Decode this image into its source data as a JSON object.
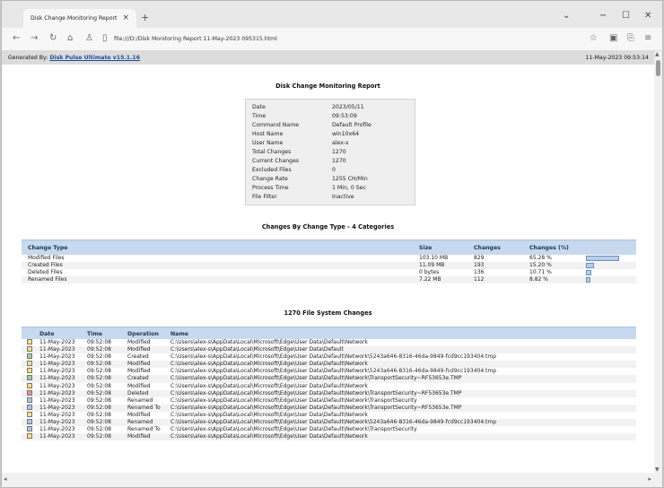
{
  "browser": {
    "tab_title": "Disk Change Monitoring Report",
    "tab_close": "×",
    "new_tab": "+",
    "address": "file:///D:/Disk Monitoring Report 11-May-2023 095315.html",
    "icons": [
      "back-icon",
      "forward-icon",
      "reload-icon",
      "home-icon",
      "profile-icon",
      "page-icon",
      "favorite-icon",
      "collections-icon",
      "extensions-icon",
      "favorites-bar-icon"
    ],
    "window_controls": {
      "minimize": "−",
      "maximize": "☐",
      "close": "✕",
      "chevron": "⌄"
    }
  },
  "report": {
    "generated_by_label": "Generated By:",
    "generated_by_link": "Disk Pulse Ultimate v15.1.16",
    "generated_at": "11-May-2023 09:53:14",
    "title": "Disk Change Monitoring Report",
    "summary": [
      {
        "label": "Date",
        "value": "2023/05/11"
      },
      {
        "label": "Time",
        "value": "09:53:09"
      },
      {
        "label": "Command Name",
        "value": "Default Profile"
      },
      {
        "label": "Host Name",
        "value": "win10x64"
      },
      {
        "label": "User Name",
        "value": "alex-s"
      },
      {
        "label": "Total Changes",
        "value": "1270"
      },
      {
        "label": "Current Changes",
        "value": "1270"
      },
      {
        "label": "Excluded Files",
        "value": "0"
      },
      {
        "label": "Change Rate",
        "value": "1255 CH/Min"
      },
      {
        "label": "Process Time",
        "value": "1 Min, 0 Sec"
      },
      {
        "label": "File Filter",
        "value": "Inactive"
      }
    ],
    "change_types_title": "Changes By Change Type - 4 Categories",
    "change_types_headers": {
      "type": "Change Type",
      "size": "Size",
      "changes": "Changes",
      "percent": "Changes (%)"
    },
    "change_types": [
      {
        "type": "Modified Files",
        "size": "103.10 MB",
        "changes": "829",
        "percent": "65.28 %",
        "fraction": 0.6528
      },
      {
        "type": "Created Files",
        "size": "11.09 MB",
        "changes": "193",
        "percent": "15.20 %",
        "fraction": 0.152
      },
      {
        "type": "Deleted Files",
        "size": "0 bytes",
        "changes": "136",
        "percent": "10.71 %",
        "fraction": 0.1071
      },
      {
        "type": "Renamed Files",
        "size": "7.22 MB",
        "changes": "112",
        "percent": "8.82 %",
        "fraction": 0.0882
      }
    ],
    "fs_title": "1270 File System Changes",
    "fs_headers": {
      "date": "Date",
      "time": "Time",
      "operation": "Operation",
      "name": "Name"
    },
    "operation_colors": {
      "Modified": "#f6e27a",
      "Created": "#8fd68f",
      "Deleted": "#f08c8c",
      "Renamed": "#a9c8ec",
      "Renamed To": "#a9c8ec"
    },
    "fs_rows": [
      {
        "date": "11-May-2023",
        "time": "09:52:08",
        "operation": "Modified",
        "name": "C:\\Users\\alex-s\\AppData\\Local\\Microsoft\\Edge\\User Data\\Default\\Network"
      },
      {
        "date": "11-May-2023",
        "time": "09:52:08",
        "operation": "Modified",
        "name": "C:\\Users\\alex-s\\AppData\\Local\\Microsoft\\Edge\\User Data\\Default"
      },
      {
        "date": "11-May-2023",
        "time": "09:52:08",
        "operation": "Created",
        "name": "C:\\Users\\alex-s\\AppData\\Local\\Microsoft\\Edge\\User Data\\Default\\Network\\5243a646-8316-46da-9849-fcd9cc193404.tmp"
      },
      {
        "date": "11-May-2023",
        "time": "09:52:08",
        "operation": "Modified",
        "name": "C:\\Users\\alex-s\\AppData\\Local\\Microsoft\\Edge\\User Data\\Default\\Network"
      },
      {
        "date": "11-May-2023",
        "time": "09:52:08",
        "operation": "Modified",
        "name": "C:\\Users\\alex-s\\AppData\\Local\\Microsoft\\Edge\\User Data\\Default\\Network\\5243a646-8316-46da-9849-fcd9cc193404.tmp"
      },
      {
        "date": "11-May-2023",
        "time": "09:52:08",
        "operation": "Created",
        "name": "C:\\Users\\alex-s\\AppData\\Local\\Microsoft\\Edge\\User Data\\Default\\Network\\TransportSecurity~RF53653e.TMP"
      },
      {
        "date": "11-May-2023",
        "time": "09:52:08",
        "operation": "Modified",
        "name": "C:\\Users\\alex-s\\AppData\\Local\\Microsoft\\Edge\\User Data\\Default\\Network"
      },
      {
        "date": "11-May-2023",
        "time": "09:52:08",
        "operation": "Deleted",
        "name": "C:\\Users\\alex-s\\AppData\\Local\\Microsoft\\Edge\\User Data\\Default\\Network\\TransportSecurity~RF53653e.TMP"
      },
      {
        "date": "11-May-2023",
        "time": "09:52:08",
        "operation": "Renamed",
        "name": "C:\\Users\\alex-s\\AppData\\Local\\Microsoft\\Edge\\User Data\\Default\\Network\\TransportSecurity"
      },
      {
        "date": "11-May-2023",
        "time": "09:52:08",
        "operation": "Renamed To",
        "name": "C:\\Users\\alex-s\\AppData\\Local\\Microsoft\\Edge\\User Data\\Default\\Network\\TransportSecurity~RF53653e.TMP"
      },
      {
        "date": "11-May-2023",
        "time": "09:52:08",
        "operation": "Modified",
        "name": "C:\\Users\\alex-s\\AppData\\Local\\Microsoft\\Edge\\User Data\\Default\\Network"
      },
      {
        "date": "11-May-2023",
        "time": "09:52:08",
        "operation": "Renamed",
        "name": "C:\\Users\\alex-s\\AppData\\Local\\Microsoft\\Edge\\User Data\\Default\\Network\\5243a646-8316-46da-9849-fcd9cc193404.tmp"
      },
      {
        "date": "11-May-2023",
        "time": "09:52:08",
        "operation": "Renamed To",
        "name": "C:\\Users\\alex-s\\AppData\\Local\\Microsoft\\Edge\\User Data\\Default\\Network\\TransportSecurity"
      },
      {
        "date": "11-May-2023",
        "time": "09:52:08",
        "operation": "Modified",
        "name": "C:\\Users\\alex-s\\AppData\\Local\\Microsoft\\Edge\\User Data\\Default\\Network"
      }
    ]
  }
}
